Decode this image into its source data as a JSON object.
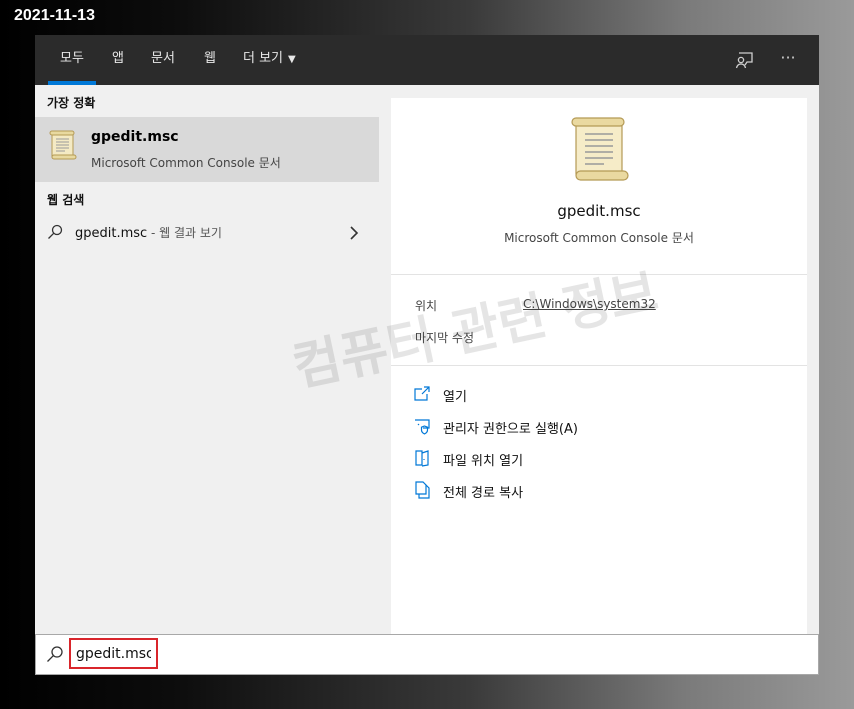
{
  "date_stamp": "2021-11-13",
  "tabs": [
    {
      "label": "모두",
      "active": true
    },
    {
      "label": "앱"
    },
    {
      "label": "문서"
    },
    {
      "label": "웹"
    },
    {
      "label": "더 보기"
    }
  ],
  "toolbar": {
    "feedback_icon": "feedback-icon",
    "more_label": "···"
  },
  "best_match": {
    "header": "가장 정확",
    "title": "gpedit.msc",
    "subtitle": "Microsoft Common Console 문서",
    "icon": "scroll-document-icon"
  },
  "web_search": {
    "header": "웹 검색",
    "query": "gpedit.msc",
    "suffix": " - 웹 결과 보기"
  },
  "details": {
    "title": "gpedit.msc",
    "subtitle": "Microsoft Common Console 문서",
    "location_label": "위치",
    "location_value": "C:\\Windows\\system32",
    "modified_label": "마지막 수정"
  },
  "actions": [
    {
      "label": "열기",
      "icon": "open-icon"
    },
    {
      "label": "관리자 권한으로 실행(A)",
      "icon": "run-as-admin-icon"
    },
    {
      "label": "파일 위치 열기",
      "icon": "open-file-location-icon"
    },
    {
      "label": "전체 경로 복사",
      "icon": "copy-path-icon"
    }
  ],
  "search": {
    "value": "gpedit.msc"
  },
  "watermark": "컴퓨터 관련 정보",
  "colors": {
    "accent": "#0078d7",
    "highlight_border": "#d9252b",
    "tabbar": "#2b2b2b"
  }
}
